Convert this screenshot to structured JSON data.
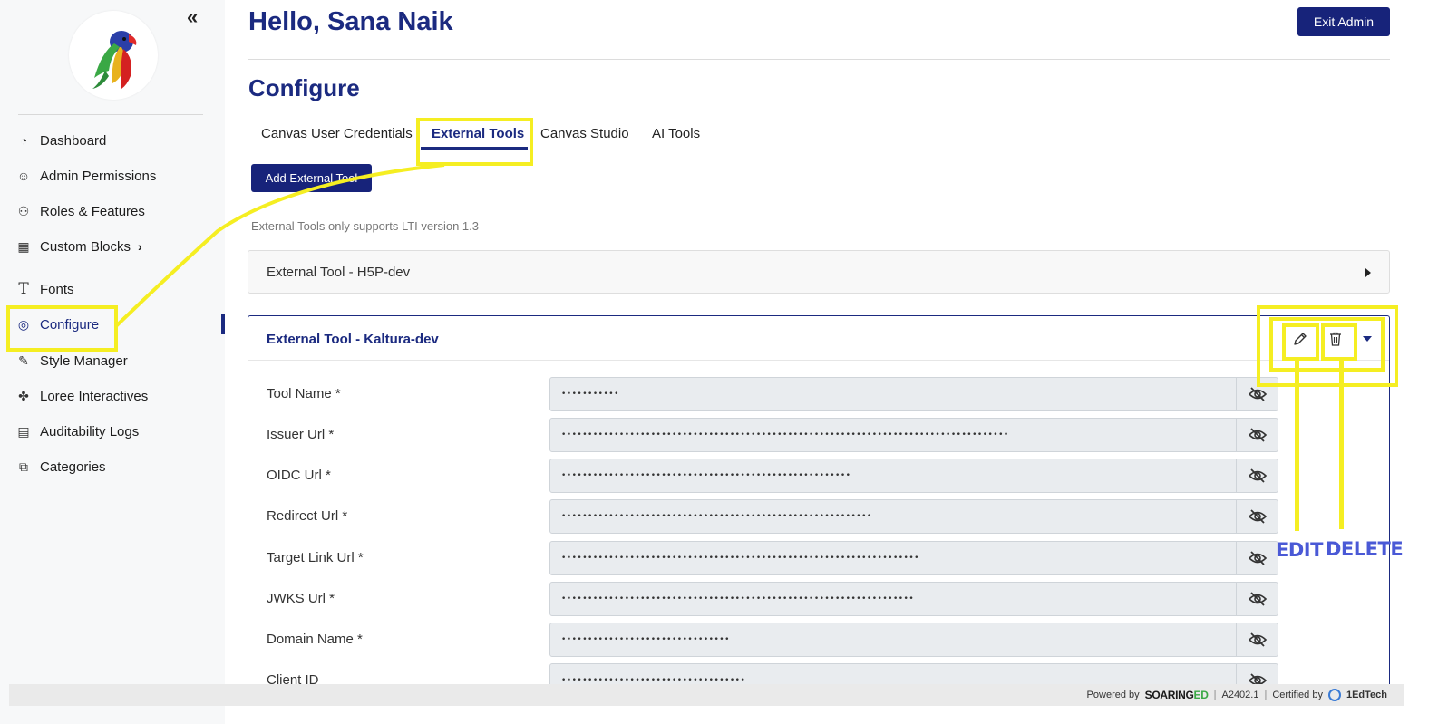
{
  "sidebar": {
    "collapse_glyph": "«",
    "items": [
      {
        "label": "Dashboard",
        "icon": "gauge-icon",
        "glyph": "◔"
      },
      {
        "label": "Admin Permissions",
        "icon": "user-key-icon",
        "glyph": "☺"
      },
      {
        "label": "Roles & Features",
        "icon": "roles-icon",
        "glyph": "⚇"
      },
      {
        "label": "Custom Blocks",
        "icon": "blocks-icon",
        "glyph": "▦"
      },
      {
        "label": "Fonts",
        "icon": "font-icon",
        "glyph": "T"
      },
      {
        "label": "Configure",
        "icon": "fingerprint-icon",
        "glyph": "◎"
      },
      {
        "label": "Style Manager",
        "icon": "edit-square-icon",
        "glyph": "✎"
      },
      {
        "label": "Loree Interactives",
        "icon": "interactives-icon",
        "glyph": "✤"
      },
      {
        "label": "Auditability Logs",
        "icon": "log-icon",
        "glyph": "▤"
      },
      {
        "label": "Categories",
        "icon": "categories-icon",
        "glyph": "⧉"
      }
    ],
    "custom_blocks_chevron": "›"
  },
  "header": {
    "greeting": "Hello, Sana Naik",
    "exit_label": "Exit Admin"
  },
  "main": {
    "title": "Configure",
    "tabs": [
      {
        "label": "Canvas User Credentials"
      },
      {
        "label": "External Tools"
      },
      {
        "label": "Canvas Studio"
      },
      {
        "label": "AI Tools"
      }
    ],
    "add_button": "Add External Tool",
    "lti_note": "External Tools only supports LTI version 1.3",
    "panels": [
      {
        "title": "External Tool - H5P-dev"
      },
      {
        "title": "External Tool - Kaltura-dev"
      }
    ],
    "fields": [
      {
        "label": "Tool Name *",
        "value": "•••••••••••"
      },
      {
        "label": "Issuer Url *",
        "value": "•••••••••••••••••••••••••••••••••••••••••••••••••••••••••••••••••••••••••••••••••••••"
      },
      {
        "label": "OIDC Url *",
        "value": "•••••••••••••••••••••••••••••••••••••••••••••••••••••••"
      },
      {
        "label": "Redirect Url *",
        "value": "•••••••••••••••••••••••••••••••••••••••••••••••••••••••••••"
      },
      {
        "label": "Target Link Url *",
        "value": "••••••••••••••••••••••••••••••••••••••••••••••••••••••••••••••••••••"
      },
      {
        "label": "JWKS Url *",
        "value": "•••••••••••••••••••••••••••••••••••••••••••••••••••••••••••••••••••"
      },
      {
        "label": "Domain Name *",
        "value": "••••••••••••••••••••••••••••••••"
      },
      {
        "label": "Client ID",
        "value": "•••••••••••••••••••••••••••••••••••"
      }
    ]
  },
  "annotations": {
    "edit": "EDIT",
    "delete": "DELETE",
    "color": "#f5ee22",
    "text_color": "#4a59d6"
  },
  "footer": {
    "powered_by": "Powered by",
    "brand_a": "SOARING",
    "brand_b": "ED",
    "version": "A2402.1",
    "certified_by": "Certified by",
    "cert_org": "1EdTech"
  },
  "colors": {
    "primary": "#1b2a80",
    "button": "#17237a",
    "input_bg": "#e9ecef"
  }
}
